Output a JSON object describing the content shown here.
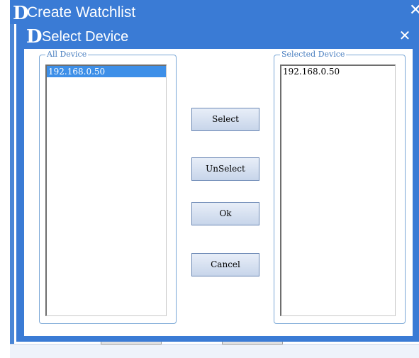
{
  "background_window": {
    "title": "Create Watchlist",
    "logo": "D",
    "close_icon": "close-icon"
  },
  "dialog": {
    "title": "Select Device",
    "logo": "D",
    "close_symbol": "✕",
    "all_devices": {
      "label": "All Device",
      "items": [
        {
          "text": "192.168.0.50",
          "selected": true
        }
      ]
    },
    "selected_devices": {
      "label": "Selected Device",
      "items": [
        {
          "text": "192.168.0.50",
          "selected": false
        }
      ]
    },
    "buttons": {
      "select": "Select",
      "unselect": "UnSelect",
      "ok": "Ok",
      "cancel": "Cancel"
    }
  },
  "colors": {
    "titlebar": "#3a7bd5",
    "selection": "#3d8fe8",
    "group_border": "#7aa7d6"
  }
}
